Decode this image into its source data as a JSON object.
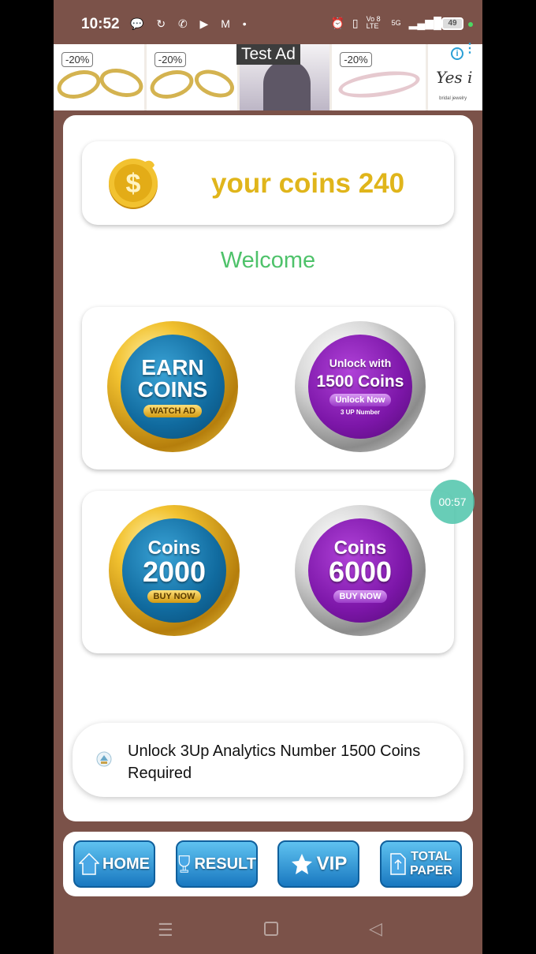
{
  "status_bar": {
    "time": "10:52",
    "left_icons": "💬 ↻ ✆ ▶ M •",
    "network": "Vo 8 LTE",
    "signal": "5G",
    "battery": "49"
  },
  "ad_banner": {
    "test_ad_label": "Test Ad",
    "discounts": [
      "-20%",
      "-20%",
      "-20%"
    ],
    "info_icon": "info-icon",
    "logo_text": "Yes i",
    "logo_subtext": "bridal jewelry"
  },
  "coins_panel": {
    "text": "your coins 240"
  },
  "welcome": "Welcome",
  "tiles": {
    "earn": {
      "line1": "EARN",
      "line2": "COINS",
      "pill": "WATCH AD"
    },
    "unlock": {
      "line1": "Unlock with",
      "line2": "1500 Coins",
      "pill": "Unlock Now",
      "sub": "3 UP Number"
    },
    "coins2000": {
      "line1": "Coins",
      "line2": "2000",
      "pill": "BUY NOW"
    },
    "coins6000": {
      "line1": "Coins",
      "line2": "6000",
      "pill": "BUY NOW"
    }
  },
  "timer": "00:57",
  "unlock_bar": {
    "text": "Unlock 3Up Analytics Number 1500 Coins Required"
  },
  "bottom_nav": {
    "home": "HOME",
    "result": "RESULT",
    "vip": "VIP",
    "total_paper_line1": "TOTAL",
    "total_paper_line2": "PAPER"
  },
  "colors": {
    "background": "#7b5249",
    "coins_text": "#e0b51b",
    "welcome": "#4ec26a",
    "nav_button": "#1978c0"
  }
}
